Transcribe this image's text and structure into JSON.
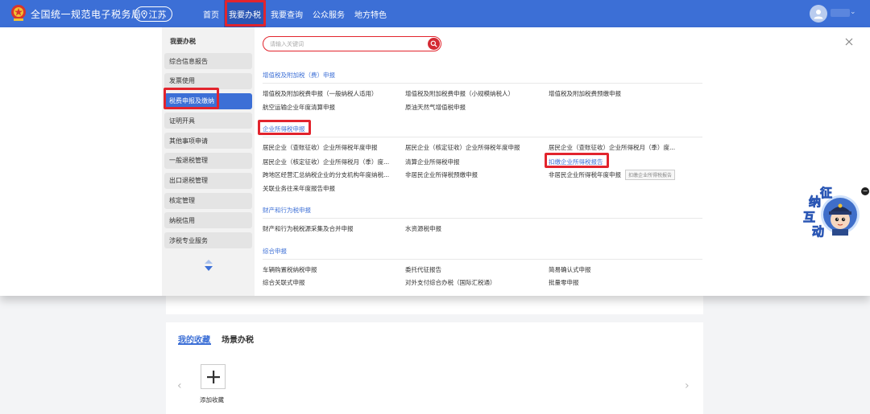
{
  "header": {
    "site_title": "全国统一规范电子税务局",
    "region": "江苏",
    "nav": [
      "首页",
      "我要办税",
      "我要查询",
      "公众服务",
      "地方特色"
    ]
  },
  "categories": {
    "title": "我要办税",
    "items": [
      "综合信息报告",
      "发票使用",
      "税费申报及缴纳",
      "证明开具",
      "其他事项申请",
      "一般退税管理",
      "出口退税管理",
      "核定管理",
      "纳税信用",
      "涉税专业服务"
    ]
  },
  "search": {
    "placeholder": "请输入关键词"
  },
  "sections": {
    "vat": {
      "title": "增值税及附加税（费）申报",
      "items": [
        "增值税及附加税费申报（一般纳税人适用）",
        "增值税及附加税费申报（小规模纳税人）",
        "增值税及附加税费预缴申报",
        "航空运输企业年度清算申报",
        "原油天然气增值税申报"
      ]
    },
    "cit": {
      "title": "企业所得税申报",
      "items": [
        "居民企业（查账征收）企业所得税年度申报",
        "居民企业（核定征收）企业所得税年度申报",
        "居民企业（查账征收）企业所得税月（季）度...",
        "居民企业（核定征收）企业所得税月（季）度...",
        "清算企业所得税申报",
        "扣缴企业所得税报告",
        "跨地区经营汇总纳税企业的分支机构年度纳税...",
        "非居民企业所得税预缴申报",
        "非居民企业所得税年度申报",
        "关联业务往来年度报告申报"
      ],
      "tooltip": "扣缴企业所得税报告"
    },
    "property": {
      "title": "财产和行为税申报",
      "items": [
        "财产和行为税税源采集及合并申报",
        "水资源税申报"
      ]
    },
    "general": {
      "title": "综合申报",
      "items": [
        "车辆购置税纳税申报",
        "委托代征报告",
        "简易确认式申报",
        "综合关联式申报",
        "对外支付综合办税（国际汇税通）",
        "批量零申报"
      ]
    }
  },
  "favorites": {
    "tabs": [
      "我的收藏",
      "场景办税"
    ],
    "add_label": "添加收藏"
  },
  "mascot": {
    "text": [
      "征",
      "纳",
      "互",
      "动"
    ]
  },
  "colors": {
    "brand": "#3c6fd6",
    "highlight": "#e2242d"
  }
}
